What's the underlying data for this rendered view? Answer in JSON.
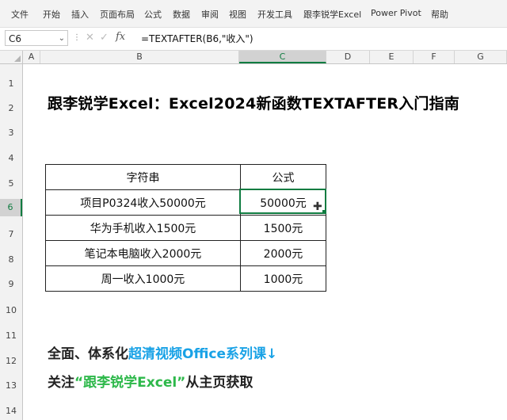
{
  "ribbon": {
    "tabs": [
      "文件",
      "开始",
      "插入",
      "页面布局",
      "公式",
      "数据",
      "审阅",
      "视图",
      "开发工具",
      "跟李锐学Excel",
      "Power Pivot",
      "帮助"
    ]
  },
  "formula_bar": {
    "name_box": "C6",
    "formula": "=TEXTAFTER(B6,\"收入\")"
  },
  "columns": [
    "A",
    "B",
    "C",
    "D",
    "E",
    "F",
    "G"
  ],
  "selected_column": "C",
  "rows": [
    "1",
    "2",
    "3",
    "4",
    "5",
    "6",
    "7",
    "8",
    "9",
    "10",
    "11",
    "12",
    "13",
    "14"
  ],
  "selected_row": "6",
  "sheet": {
    "title": "跟李锐学Excel：Excel2024新函数TEXTAFTER入门指南",
    "table": {
      "headers": [
        "字符串",
        "公式"
      ],
      "rows": [
        [
          "项目P0324收入50000元",
          "50000元"
        ],
        [
          "华为手机收入1500元",
          "1500元"
        ],
        [
          "笔记本电脑收入2000元",
          "2000元"
        ],
        [
          "周一收入1000元",
          "1000元"
        ]
      ]
    },
    "promo1": {
      "prefix": "全面、体系化",
      "highlight": "超清视频Office系列课↓"
    },
    "promo2": {
      "prefix": "关注",
      "highlight": "“跟李锐学Excel”",
      "suffix": "从主页获取"
    }
  },
  "colors": {
    "accent": "#107c41",
    "highlight_blue": "#19a2e6",
    "highlight_green": "#2db84a"
  }
}
